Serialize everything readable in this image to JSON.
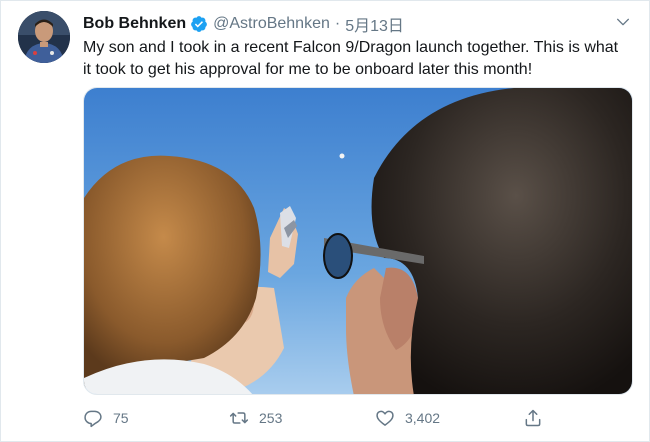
{
  "tweet": {
    "author_name": "Bob Behnken",
    "handle": "@AstroBehnken",
    "separator": "·",
    "date": "5月13日",
    "text": "My son and I took in a recent Falcon 9/Dragon launch together. This is what it took to get his approval for me to be onboard later this month!",
    "verified": true
  },
  "icons": {
    "avatar": "avatar-image",
    "verified": "verified-badge-icon",
    "menu": "chevron-down-icon",
    "reply": "reply-icon",
    "retweet": "retweet-icon",
    "like": "heart-icon",
    "share": "share-icon"
  },
  "actions": {
    "reply_count": "75",
    "retweet_count": "253",
    "like_count": "3,402"
  },
  "colors": {
    "text": "#14171a",
    "secondary": "#657786",
    "verified": "#1da1f2",
    "border": "#e1e8ed",
    "sky": "#4a8fd1"
  }
}
